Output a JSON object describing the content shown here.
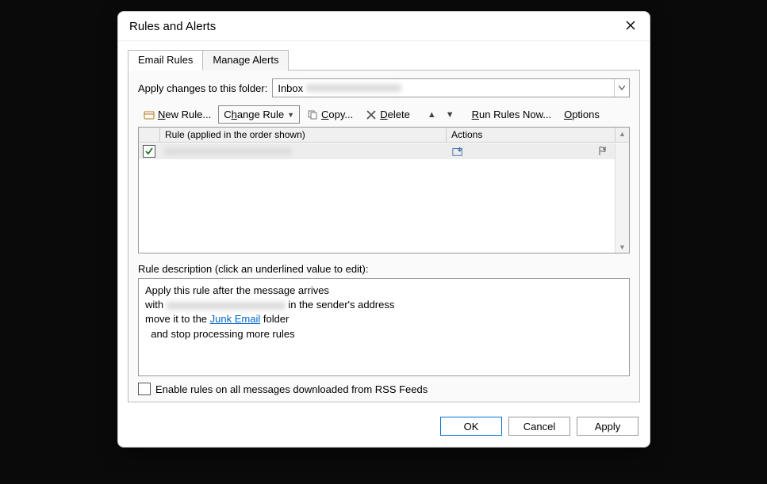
{
  "dialog": {
    "title": "Rules and Alerts"
  },
  "tabs": {
    "email_rules": "Email Rules",
    "manage_alerts": "Manage Alerts"
  },
  "folder": {
    "label": "Apply changes to this folder:",
    "selected": "Inbox"
  },
  "toolbar": {
    "new_rule": "New Rule...",
    "change_rule": "Change Rule",
    "copy": "Copy...",
    "delete": "Delete",
    "run_now": "Run Rules Now...",
    "options": "Options"
  },
  "list": {
    "col_rule": "Rule (applied in the order shown)",
    "col_actions": "Actions"
  },
  "description": {
    "label": "Rule description (click an underlined value to edit):",
    "line1": "Apply this rule after the message arrives",
    "line2_prefix": "with ",
    "line2_suffix": " in the sender's address",
    "line3_prefix": "move it to the ",
    "line3_link": "Junk Email",
    "line3_suffix": " folder",
    "line4": "  and stop processing more rules"
  },
  "rss": {
    "label": "Enable rules on all messages downloaded from RSS Feeds"
  },
  "buttons": {
    "ok": "OK",
    "cancel": "Cancel",
    "apply": "Apply"
  }
}
